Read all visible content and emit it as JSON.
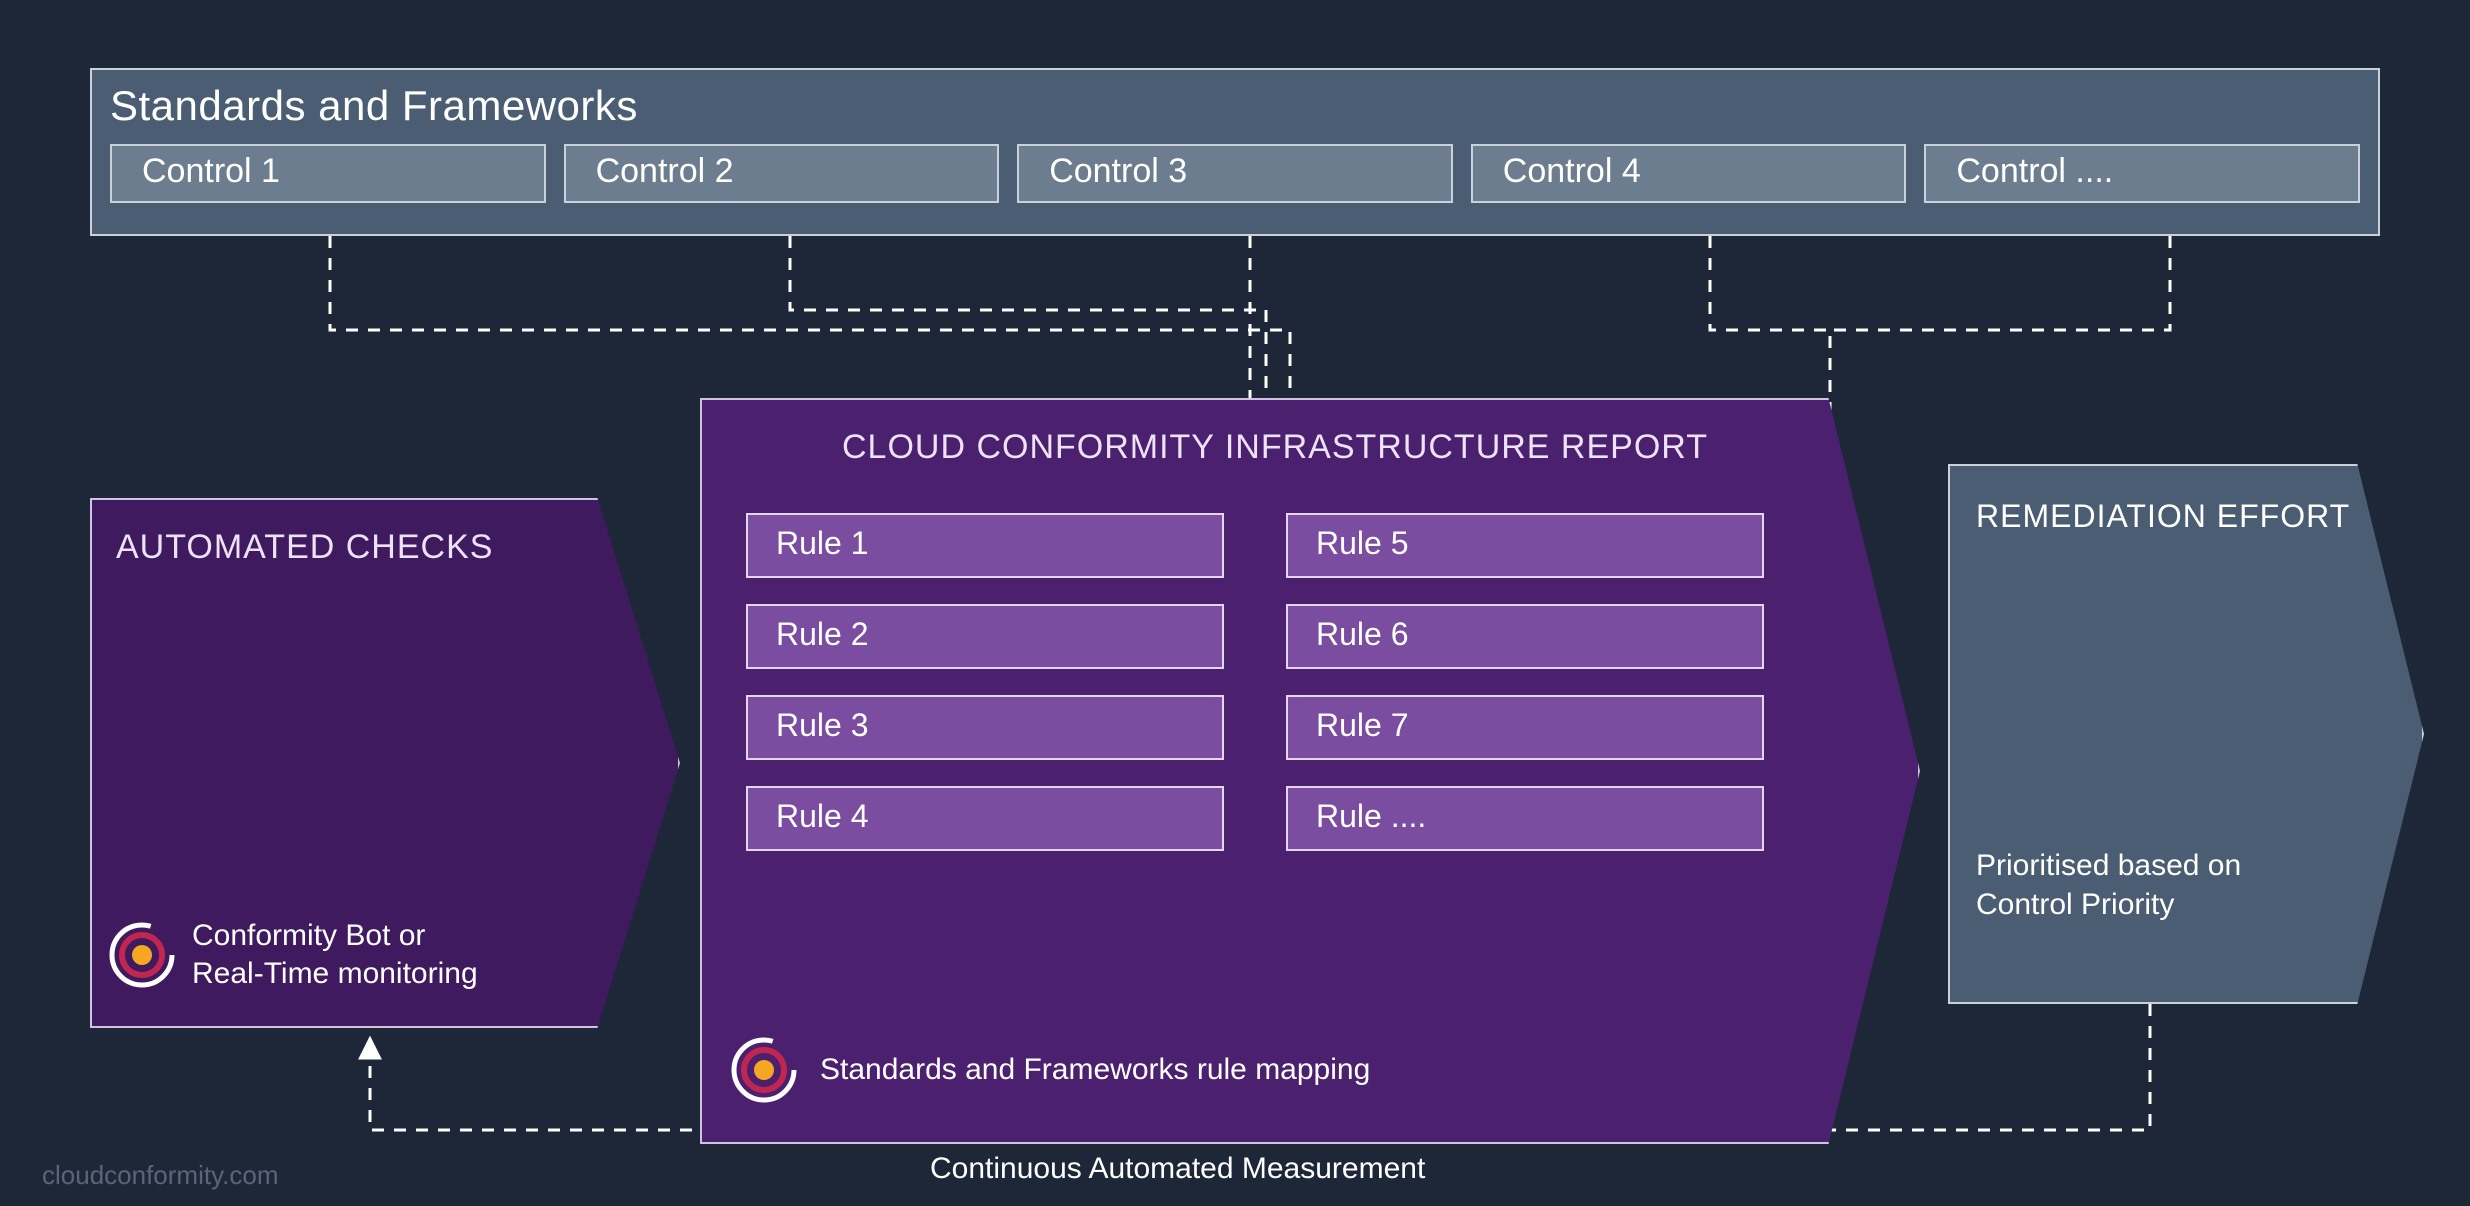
{
  "standards": {
    "title": "Standards and Frameworks",
    "controls": [
      "Control 1",
      "Control 2",
      "Control 3",
      "Control 4",
      "Control ...."
    ]
  },
  "auto_checks": {
    "title": "AUTOMATED CHECKS",
    "bot_line1": "Conformity Bot or",
    "bot_line2": "Real-Time monitoring"
  },
  "report": {
    "title": "CLOUD CONFORMITY INFRASTRUCTURE REPORT",
    "rules_left": [
      "Rule 1",
      "Rule 2",
      "Rule 3",
      "Rule 4"
    ],
    "rules_right": [
      "Rule 5",
      "Rule 6",
      "Rule 7",
      "Rule ...."
    ],
    "mapping": "Standards and Frameworks rule mapping"
  },
  "remediation": {
    "title": "REMEDIATION EFFORT",
    "desc": "Prioritised based on Control Priority"
  },
  "feedback_label": "Continuous Automated Measurement",
  "watermark": "cloudconformity.com"
}
